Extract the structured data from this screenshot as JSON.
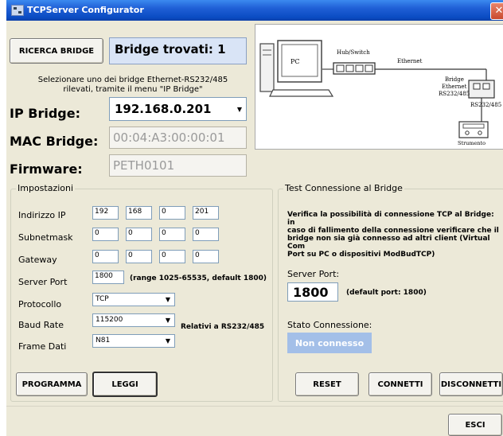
{
  "window": {
    "title": "TCPServer Configurator",
    "close_glyph": "✕"
  },
  "search": {
    "button_label": "RICERCA BRIDGE",
    "count_text": "Bridge trovati: 1"
  },
  "hint": {
    "line1": "Selezionare uno dei bridge Ethernet-RS232/485",
    "line2": "rilevati, tramite il menu \"IP Bridge\""
  },
  "bridge": {
    "ip_label": "IP Bridge:",
    "ip_value": "192.168.0.201",
    "mac_label": "MAC Bridge:",
    "mac_value": "00:04:A3:00:00:01",
    "fw_label": "Firmware:",
    "fw_value": "PETH0101"
  },
  "diagram": {
    "pc": "PC",
    "hub": "Hub/Switch",
    "ethernet": "Ethernet",
    "bridge1": "Bridge",
    "bridge2": "Ethernet",
    "bridge3": "RS232/485",
    "rs": "RS232/485",
    "instrument": "Strumento"
  },
  "settings": {
    "legend": "Impostazioni",
    "ip_label": "Indirizzo  IP",
    "ip": [
      "192",
      "168",
      "0",
      "201"
    ],
    "mask_label": "Subnetmask",
    "mask": [
      "0",
      "0",
      "0",
      "0"
    ],
    "gw_label": "Gateway",
    "gw": [
      "0",
      "0",
      "0",
      "0"
    ],
    "port_label": "Server Port",
    "port_value": "1800",
    "port_hint": "(range 1025-65535, default 1800)",
    "proto_label": "Protocollo",
    "proto_value": "TCP",
    "baud_label": "Baud Rate",
    "baud_value": "115200",
    "frame_label": "Frame Dati",
    "frame_value": "N81",
    "rs_note": "Relativi a RS232/485"
  },
  "actions": {
    "program": "PROGRAMMA",
    "read": "LEGGI",
    "reset": "RESET",
    "connect": "CONNETTI",
    "disconnect": "DISCONNETTI",
    "exit": "ESCI"
  },
  "test": {
    "legend": "Test Connessione al Bridge",
    "desc_1": "Verifica la possibilità di connessione TCP al Bridge:  in",
    "desc_2": "caso di fallimento della connessione verificare che il",
    "desc_3": "bridge non sia già connesso ad altri client (Virtual Com",
    "desc_4": "Port su PC o dispositivi ModBudTCP)",
    "port_label": "Server Port:",
    "port_value": "1800",
    "port_default": "(default port: 1800)",
    "status_label": "Stato Connessione:",
    "status_value": "Non connesso"
  },
  "colors": {
    "title_bar": "#1f5fd6",
    "status_bg": "#a3bfe8",
    "count_bg": "#d9e4f6"
  }
}
